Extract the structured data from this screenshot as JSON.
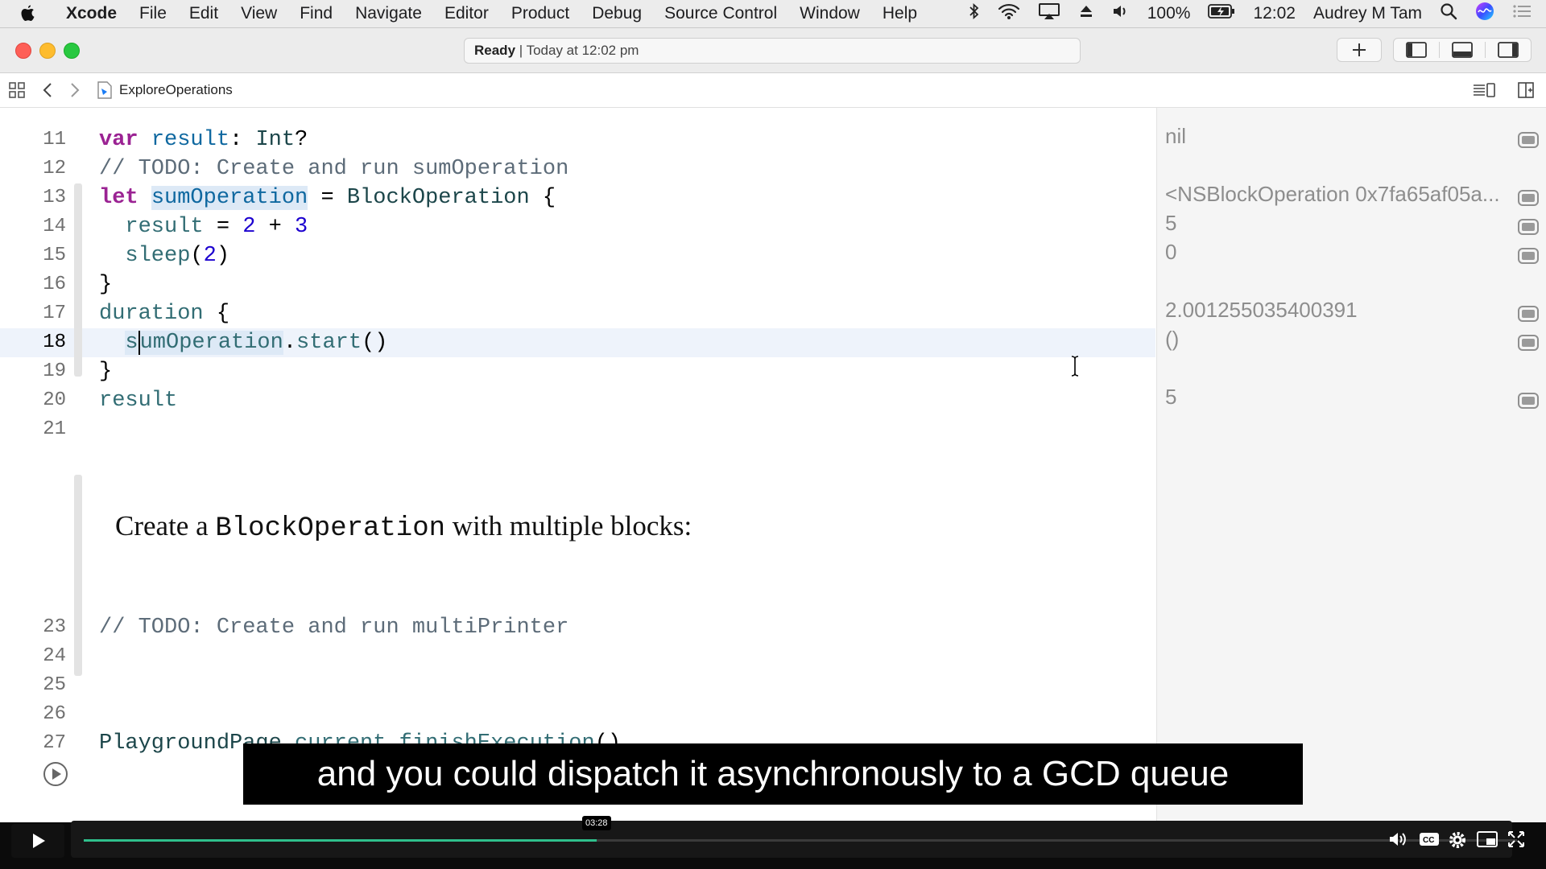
{
  "menubar": {
    "app": "Xcode",
    "items": [
      "File",
      "Edit",
      "View",
      "Find",
      "Navigate",
      "Editor",
      "Product",
      "Debug",
      "Source Control",
      "Window",
      "Help"
    ],
    "battery": "100%",
    "clock": "12:02",
    "user": "Audrey M Tam"
  },
  "toolbar": {
    "status_bold": "Ready",
    "status_rest": " | Today at 12:02 pm"
  },
  "jumpbar": {
    "file": "ExploreOperations"
  },
  "editor": {
    "markup_prefix": "Create a ",
    "markup_code": "BlockOperation",
    "markup_suffix": " with multiple blocks:"
  },
  "results": [
    "nil",
    "<NSBlockOperation 0x7fa65af05a...",
    "5",
    "0",
    "2.001255035400391",
    "()",
    "5"
  ],
  "caption": "and you could dispatch it asynchronously to a GCD queue",
  "player": {
    "time": "03:28",
    "progress": 0.358
  },
  "colors": {
    "accent": "#2fbf8c",
    "keyword": "#9b2393",
    "identifier": "#0f68a0"
  }
}
